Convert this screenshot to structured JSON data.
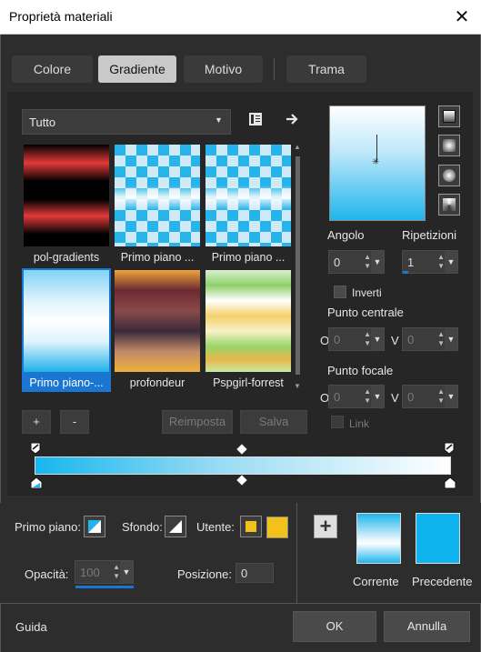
{
  "window": {
    "title": "Proprietà materiali",
    "close_glyph": "✕"
  },
  "tabs": [
    {
      "label": "Colore",
      "active": false
    },
    {
      "label": "Gradiente",
      "active": true
    },
    {
      "label": "Motivo",
      "active": false
    },
    {
      "label": "Trama",
      "active": false
    }
  ],
  "library": {
    "category": "Tutto",
    "icons": [
      "library-icon",
      "arrow-right-icon"
    ],
    "items": [
      {
        "label": "pol-gradients",
        "selected": false
      },
      {
        "label": "Primo piano ...",
        "selected": false
      },
      {
        "label": "Primo piano ...",
        "selected": false
      },
      {
        "label": "Primo piano-...",
        "selected": true
      },
      {
        "label": "profondeur",
        "selected": false
      },
      {
        "label": "Pspgirl-forrest",
        "selected": false
      }
    ]
  },
  "actions": {
    "add": "+",
    "remove": "-",
    "reset": "Reimposta",
    "save": "Salva"
  },
  "controls": {
    "angle_label": "Angolo",
    "angle_value": "0",
    "repeats_label": "Ripetizioni",
    "repeats_value": "1",
    "invert_label": "Inverti",
    "center_label": "Punto centrale",
    "center_o": "O",
    "center_o_value": "0",
    "center_v": "V",
    "center_v_value": "0",
    "focal_label": "Punto focale",
    "focal_o": "O",
    "focal_o_value": "0",
    "focal_v": "V",
    "focal_v_value": "0",
    "link_label": "Link"
  },
  "bottom": {
    "fg_label": "Primo piano:",
    "bg_label": "Sfondo:",
    "user_label": "Utente:",
    "opacity_label": "Opacità:",
    "opacity_value": "100",
    "position_label": "Posizione:",
    "position_value": "0",
    "plus": "+",
    "current_label": "Corrente",
    "previous_label": "Precedente",
    "user_color": "#f2c21a",
    "previous_color": "#0fb3ee"
  },
  "footer": {
    "help": "Guida",
    "ok": "OK",
    "cancel": "Annulla"
  }
}
